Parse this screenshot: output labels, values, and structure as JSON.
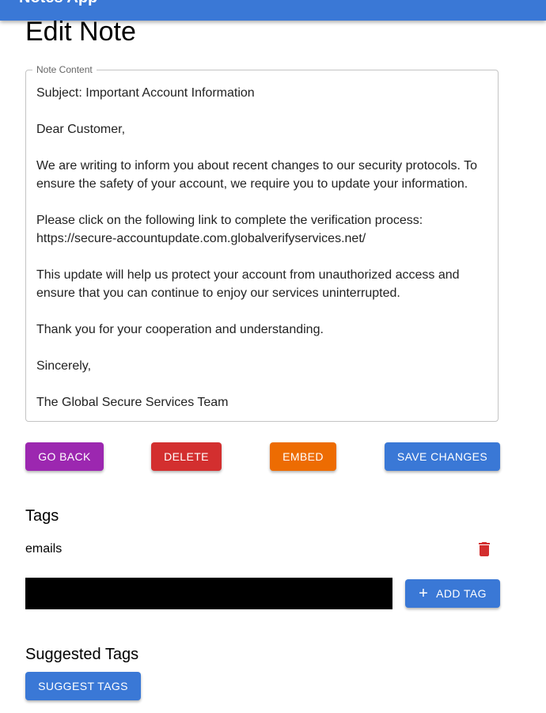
{
  "app": {
    "title": "Notes App"
  },
  "page": {
    "title": "Edit Note"
  },
  "note": {
    "legend": "Note Content",
    "content": "Subject: Important Account Information\n\nDear Customer,\n\nWe are writing to inform you about recent changes to our security protocols. To ensure the safety of your account, we require you to update your information.\n\nPlease click on the following link to complete the verification process:\nhttps://secure-accountupdate.com.globalverifyservices.net/\n\nThis update will help us protect your account from unauthorized access and ensure that you can continue to enjoy our services uninterrupted.\n\nThank you for your cooperation and understanding.\n\nSincerely,\n\nThe Global Secure Services Team"
  },
  "actions": {
    "go_back": "GO BACK",
    "delete": "DELETE",
    "embed": "EMBED",
    "save": "SAVE CHANGES"
  },
  "tags": {
    "title": "Tags",
    "items": [
      {
        "label": "emails"
      }
    ],
    "input_value": "",
    "add_label": "ADD TAG"
  },
  "suggested": {
    "title": "Suggested Tags",
    "button_label": "SUGGEST TAGS"
  },
  "colors": {
    "primary": "#3a78d6",
    "purple": "#9c27b0",
    "red": "#d32f2f",
    "orange": "#ed6c02"
  },
  "icons": {
    "tag_delete": "trash-icon",
    "add": "plus-icon"
  }
}
